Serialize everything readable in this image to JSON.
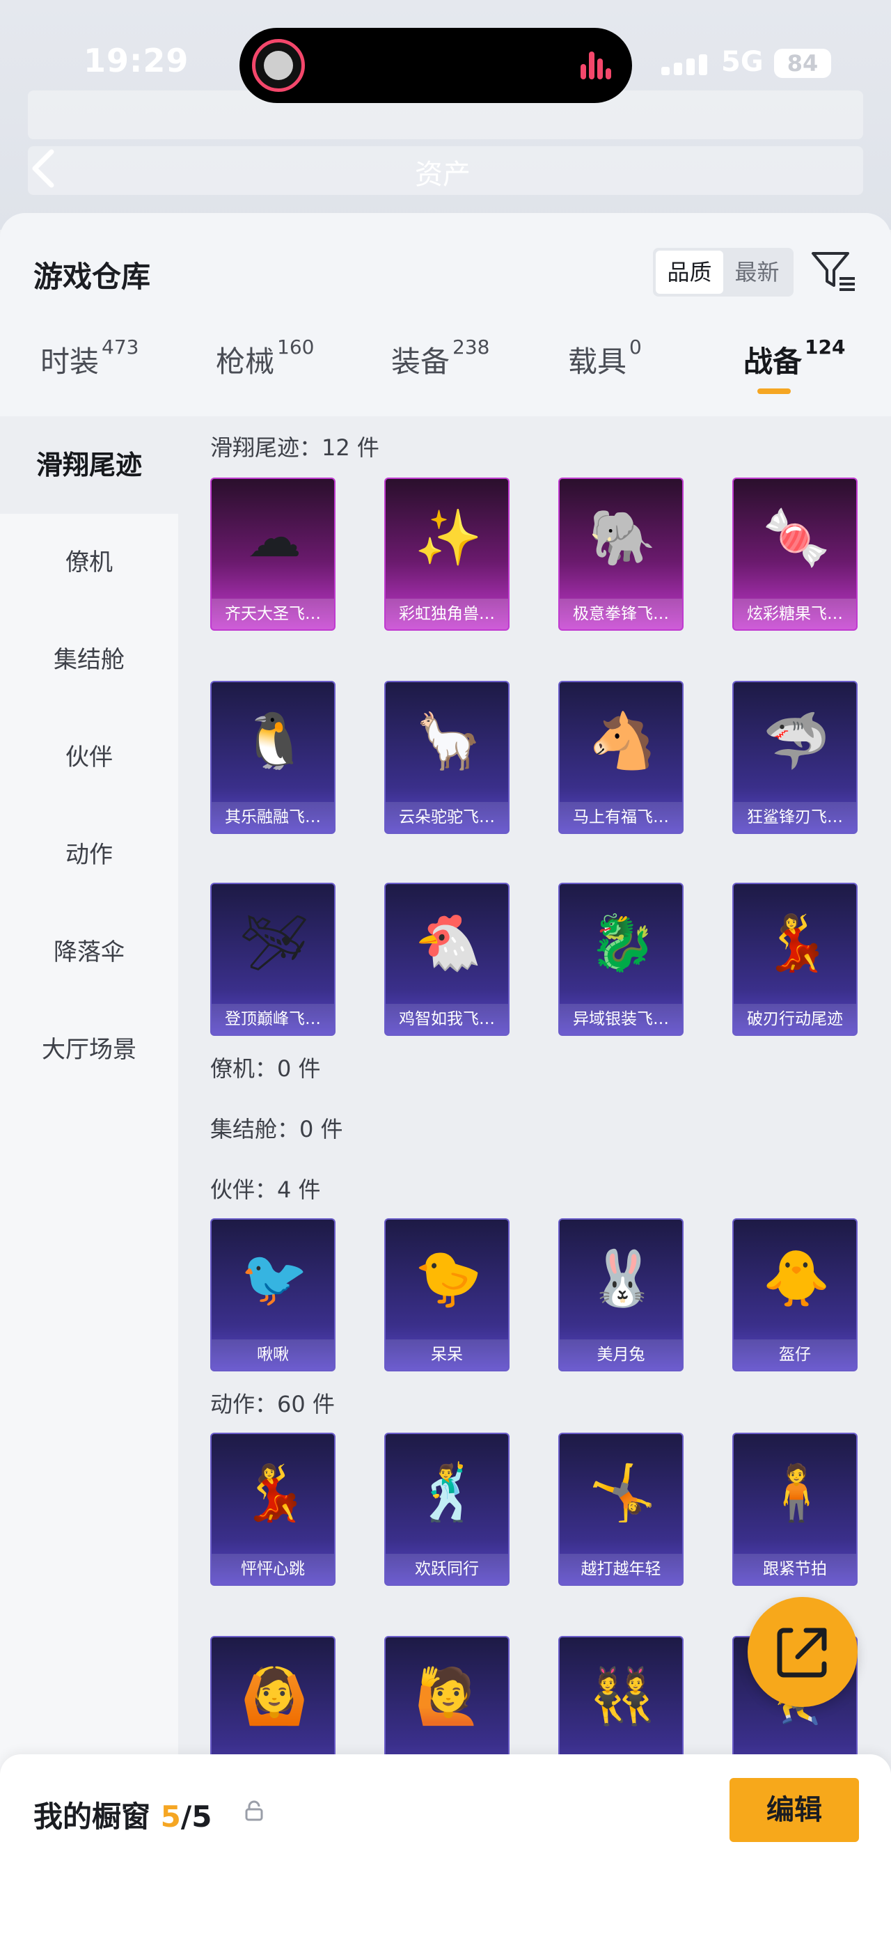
{
  "status_bar": {
    "time": "19:29",
    "network": "5G",
    "battery": "84"
  },
  "backdrop": {
    "title": "资产"
  },
  "sheet": {
    "title": "游戏仓库",
    "sort": {
      "quality": "品质",
      "newest": "最新"
    }
  },
  "tabs": [
    {
      "label": "时装",
      "count": "473"
    },
    {
      "label": "枪械",
      "count": "160"
    },
    {
      "label": "装备",
      "count": "238"
    },
    {
      "label": "载具",
      "count": "0"
    },
    {
      "label": "战备",
      "count": "124"
    }
  ],
  "sidebar": {
    "items": [
      {
        "label": "滑翔尾迹"
      },
      {
        "label": "僚机"
      },
      {
        "label": "集结舱"
      },
      {
        "label": "伙伴"
      },
      {
        "label": "动作"
      },
      {
        "label": "降落伞"
      },
      {
        "label": "大厅场景"
      }
    ]
  },
  "sections": {
    "trails": {
      "label": "滑翔尾迹：12 件",
      "items": [
        {
          "name": "齐天大圣飞…",
          "icon": "☁"
        },
        {
          "name": "彩虹独角兽…",
          "icon": "✨"
        },
        {
          "name": "极意拳锋飞…",
          "icon": "🐘"
        },
        {
          "name": "炫彩糖果飞…",
          "icon": "🍬"
        },
        {
          "name": "其乐融融飞…",
          "icon": "🐧"
        },
        {
          "name": "云朵驼驼飞…",
          "icon": "🦙"
        },
        {
          "name": "马上有福飞…",
          "icon": "🐴"
        },
        {
          "name": "狂鲨锋刃飞…",
          "icon": "🦈"
        },
        {
          "name": "登顶巅峰飞…",
          "icon": "🛩"
        },
        {
          "name": "鸡智如我飞…",
          "icon": "🐔"
        },
        {
          "name": "异域银装飞…",
          "icon": "🐉"
        },
        {
          "name": "破刃行动尾迹",
          "icon": "💃"
        }
      ]
    },
    "wingman": {
      "label": "僚机：0 件"
    },
    "pod": {
      "label": "集结舱：0 件"
    },
    "partners": {
      "label": "伙伴：4 件",
      "items": [
        {
          "name": "啾啾",
          "icon": "🐦"
        },
        {
          "name": "呆呆",
          "icon": "🐤"
        },
        {
          "name": "美月兔",
          "icon": "🐰"
        },
        {
          "name": "盔仔",
          "icon": "🐥"
        }
      ]
    },
    "emotes": {
      "label": "动作：60 件",
      "items": [
        {
          "name": "怦怦心跳",
          "icon": "💃"
        },
        {
          "name": "欢跃同行",
          "icon": "🕺"
        },
        {
          "name": "越打越年轻",
          "icon": "🤸"
        },
        {
          "name": "跟紧节拍",
          "icon": "🧍"
        },
        {
          "name": "",
          "icon": "🙆"
        },
        {
          "name": "",
          "icon": "🙋"
        },
        {
          "name": "",
          "icon": "👯"
        },
        {
          "name": "",
          "icon": "🤾"
        }
      ]
    }
  },
  "footer": {
    "title": "我的橱窗",
    "count_current": "5",
    "count_total": "/5",
    "edit_label": "编辑"
  },
  "colors": {
    "accent": "#f7a81b",
    "legend_card": "#c43ad0",
    "epic_card": "#5947c9"
  }
}
